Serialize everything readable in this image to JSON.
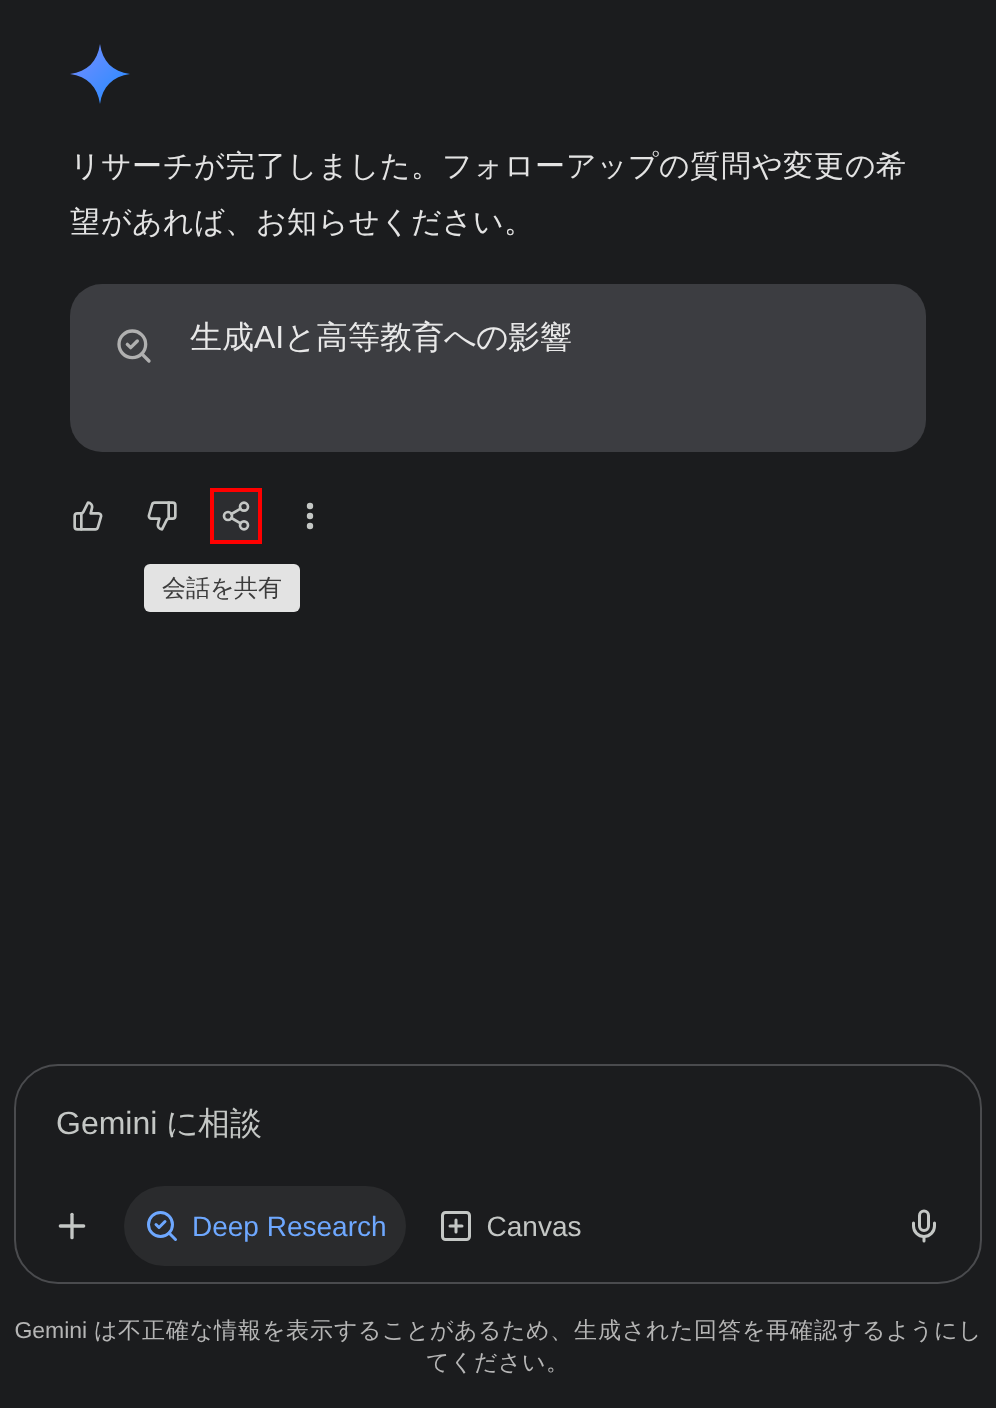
{
  "message": {
    "text": "リサーチが完了しました。フォローアップの質問や変更の希望があれば、お知らせください。"
  },
  "report_card": {
    "title": "生成AIと高等教育への影響"
  },
  "actions": [
    {
      "kind": "like",
      "highlighted": false
    },
    {
      "kind": "dislike",
      "highlighted": false
    },
    {
      "kind": "share",
      "highlighted": true
    },
    {
      "kind": "more",
      "highlighted": false
    }
  ],
  "tooltip": "会話を共有",
  "composer": {
    "placeholder": "Gemini に相談",
    "tools": [
      {
        "kind": "research",
        "label": "Deep Research",
        "selected": true
      },
      {
        "kind": "canvas",
        "label": "Canvas",
        "selected": false
      }
    ]
  },
  "disclaimer": "Gemini は不正確な情報を表示することがあるため、生成された回答を再確認するようにしてください。"
}
